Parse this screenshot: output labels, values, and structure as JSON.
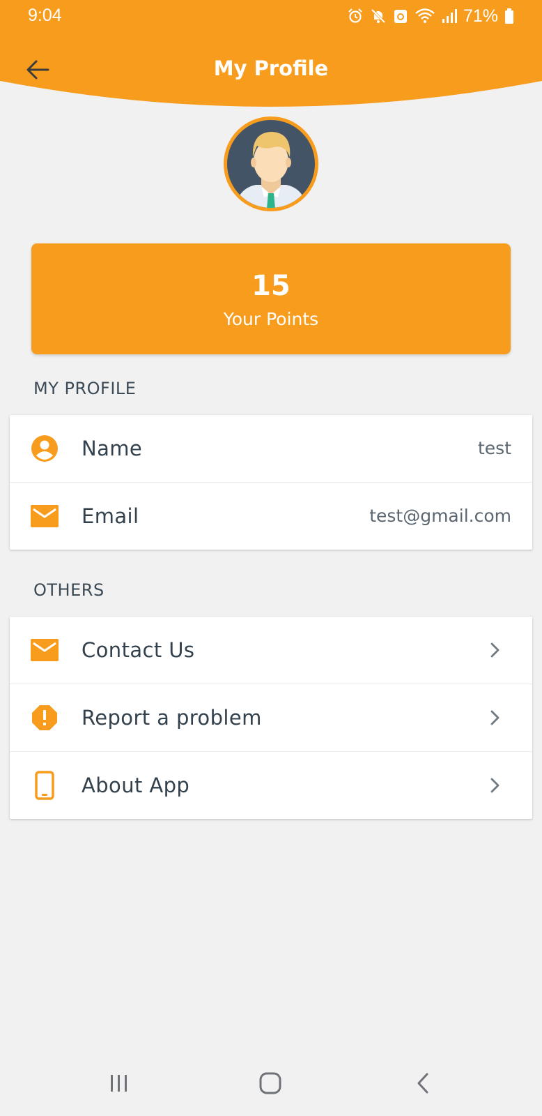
{
  "status_bar": {
    "time": "9:04",
    "battery_text": "71%",
    "icons": [
      "alarm-icon",
      "mute-icon",
      "data-saver-icon",
      "wifi-icon",
      "signal-icon",
      "battery-icon"
    ]
  },
  "header": {
    "title": "My Profile",
    "back_icon": "arrow-left-icon"
  },
  "points": {
    "value": "15",
    "label": "Your Points"
  },
  "profile_section": {
    "title": "MY PROFILE",
    "items": [
      {
        "icon": "person-icon",
        "label": "Name",
        "value": "test"
      },
      {
        "icon": "mail-icon",
        "label": "Email",
        "value": "test@gmail.com"
      }
    ]
  },
  "others_section": {
    "title": "OTHERS",
    "items": [
      {
        "icon": "mail-icon",
        "label": "Contact Us"
      },
      {
        "icon": "alert-octagon-icon",
        "label": "Report a problem"
      },
      {
        "icon": "phone-icon",
        "label": "About App"
      }
    ]
  },
  "nav_bar": {
    "buttons": [
      "recent-apps-icon",
      "home-icon",
      "back-icon"
    ]
  },
  "colors": {
    "accent": "#f89c1e",
    "background": "#f1f1f2",
    "text": "#33414d"
  }
}
